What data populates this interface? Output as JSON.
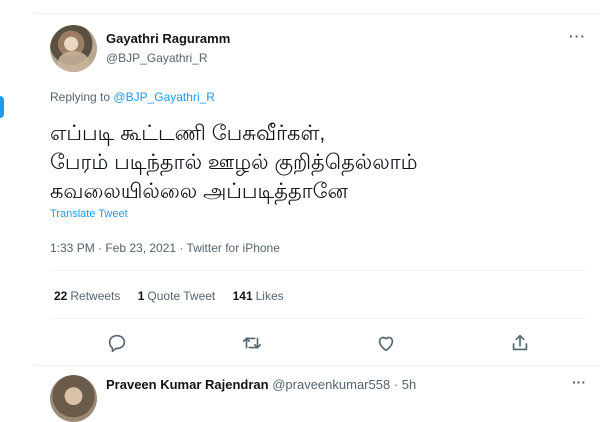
{
  "top_cut_text": "· · · · · · · · · ·",
  "tweet": {
    "author_name": "Gayathri Raguramm",
    "author_handle": "@BJP_Gayathri_R",
    "more_label": "···",
    "replying_prefix": "Replying to",
    "replying_handle": "@BJP_Gayathri_R",
    "text_lines": [
      "எப்படி கூட்டணி பேசுவீர்கள்,",
      "பேரம் படிந்தால் ஊழல் குறித்தெல்லாம்",
      "கவலையில்லை அப்படித்தானே"
    ],
    "translate_label": "Translate Tweet",
    "meta": "1:33 PM · Feb 23, 2021 · Twitter for iPhone",
    "stats": {
      "retweets_count": "22",
      "retweets_label": "Retweets",
      "quotes_count": "1",
      "quotes_label": "Quote Tweet",
      "likes_count": "141",
      "likes_label": "Likes"
    }
  },
  "actions": [
    {
      "icon": "reply-icon"
    },
    {
      "icon": "retweet-icon"
    },
    {
      "icon": "like-icon"
    },
    {
      "icon": "share-icon"
    }
  ],
  "next_reply": {
    "name": "Praveen Kumar Rajendran",
    "handle_time": "@praveenkumar558 · 5h",
    "more_label": "···"
  },
  "colors": {
    "accent": "#1d9bf0",
    "text": "#0f1419",
    "secondary": "#536471",
    "divider": "#eff3f4"
  }
}
